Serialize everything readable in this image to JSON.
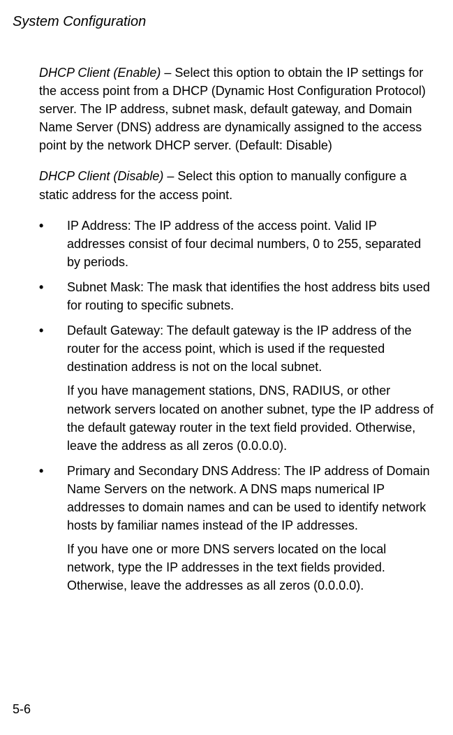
{
  "header": {
    "title": "System Configuration"
  },
  "content": {
    "para1": {
      "lead": "DHCP Client (Enable)",
      "sep": " – ",
      "body": "Select this option to obtain the IP settings for the access point from a DHCP (Dynamic Host Configuration Protocol) server. The IP address, subnet mask, default gateway, and Domain Name Server (DNS) address are dynamically assigned to the access point by the network DHCP server. (Default: Disable)"
    },
    "para2": {
      "lead": "DHCP Client (Disable)",
      "sep": " – ",
      "body": "Select this option to manually configure a static address for the access point."
    },
    "bullets": [
      {
        "text": "IP Address: The IP address of the access point. Valid IP addresses consist of four decimal numbers, 0 to 255, separated by periods."
      },
      {
        "text": "Subnet Mask: The mask that identifies the host address bits used for routing to specific subnets."
      },
      {
        "text": "Default Gateway: The default gateway is the IP address of the router for the access point, which is used if the requested destination address is not on the local subnet.",
        "sub": "If you have management stations, DNS, RADIUS, or other network servers located on another subnet, type the IP address of the default gateway router in the text field provided. Otherwise, leave the address as all zeros (0.0.0.0)."
      },
      {
        "text": "Primary and Secondary DNS Address: The IP address of Domain Name Servers on the network. A DNS maps numerical IP addresses to domain names and can be used to identify network hosts by familiar names instead of the IP addresses.",
        "sub": "If you have one or more DNS servers located on the local network, type the IP addresses in the text fields provided. Otherwise, leave the addresses as all zeros (0.0.0.0)."
      }
    ]
  },
  "footer": {
    "pagenum": "5-6"
  },
  "bullet_char": "•"
}
